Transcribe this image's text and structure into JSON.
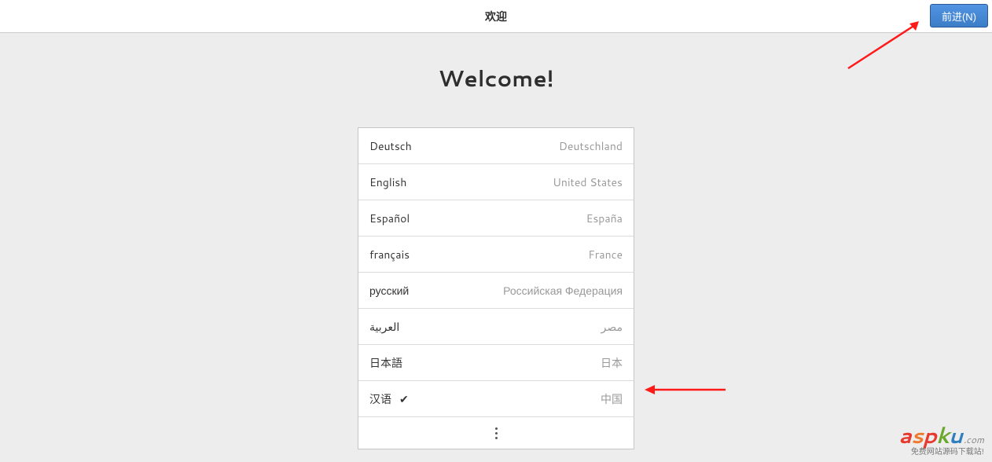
{
  "header": {
    "title": "欢迎",
    "next_button": "前进(N)"
  },
  "main": {
    "heading": "Welcome!"
  },
  "languages": [
    {
      "name": "Deutsch",
      "region": "Deutschland",
      "selected": false
    },
    {
      "name": "English",
      "region": "United States",
      "selected": false
    },
    {
      "name": "Español",
      "region": "España",
      "selected": false
    },
    {
      "name": "français",
      "region": "France",
      "selected": false
    },
    {
      "name": "русский",
      "region": "Российская Федерация",
      "selected": false
    },
    {
      "name": "العربية",
      "region": "مصر",
      "selected": false
    },
    {
      "name": "日本語",
      "region": "日本",
      "selected": false
    },
    {
      "name": "汉语",
      "region": "中国",
      "selected": true
    }
  ],
  "watermark": {
    "main": "aspku",
    "domain": ".com",
    "subtitle": "免费网站源码下载站!"
  }
}
